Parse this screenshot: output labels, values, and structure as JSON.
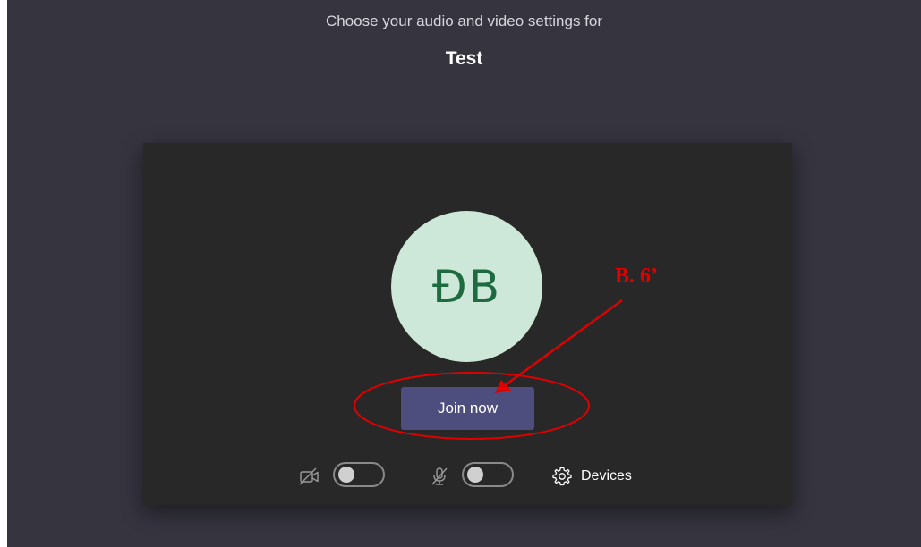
{
  "header": {
    "heading": "Choose your audio and video settings for",
    "meeting_title": "Test"
  },
  "preview": {
    "avatar_initials": "ĐB",
    "join_label": "Join now"
  },
  "controls": {
    "camera_toggle": "off",
    "mic_toggle": "off",
    "devices_label": "Devices"
  },
  "annotation": {
    "label": "B. 6’",
    "color": "#e00000"
  },
  "colors": {
    "background": "#35343f",
    "panel": "#292828",
    "avatar_bg": "#cde7d8",
    "avatar_text": "#1f6b41",
    "join_button": "#4e4e7e"
  }
}
